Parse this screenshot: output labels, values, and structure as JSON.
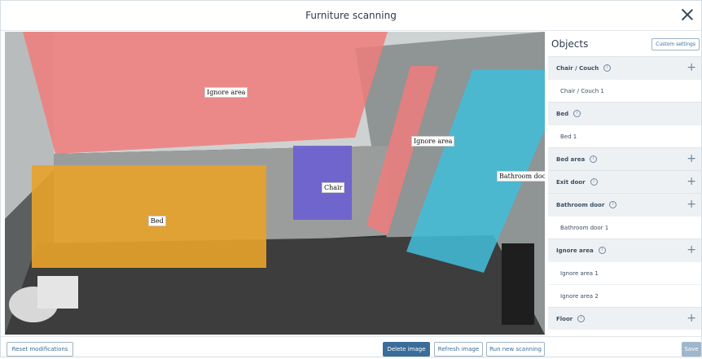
{
  "window": {
    "title": "Furniture scanning"
  },
  "regions": [
    {
      "name": "ignore-area-window",
      "label": "Ignore area",
      "color": "#f07c7c"
    },
    {
      "name": "ignore-area-door",
      "label": "Ignore area",
      "color": "#f07c7c"
    },
    {
      "name": "bed",
      "label": "Bed",
      "color": "#e8a22a"
    },
    {
      "name": "chair",
      "label": "Chair",
      "color": "#6b5fd2"
    },
    {
      "name": "bathroom-door",
      "label": "Bathroom door",
      "color": "#41bedb"
    }
  ],
  "panel": {
    "title": "Objects",
    "custom_settings": "Custom settings",
    "categories": [
      {
        "label": "Chair / Couch",
        "items": [
          "Chair / Couch 1"
        ],
        "addable": true
      },
      {
        "label": "Bed",
        "items": [
          "Bed 1"
        ],
        "addable": false
      },
      {
        "label": "Bed area",
        "items": [],
        "addable": true
      },
      {
        "label": "Exit door",
        "items": [],
        "addable": true
      },
      {
        "label": "Bathroom door",
        "items": [
          "Bathroom door 1"
        ],
        "addable": true
      },
      {
        "label": "Ignore area",
        "items": [
          "Ignore area 1",
          "Ignore area 2"
        ],
        "addable": true
      },
      {
        "label": "Floor",
        "items": [],
        "addable": true
      }
    ]
  },
  "footer": {
    "reset": "Reset modifications",
    "delete": "Delete image",
    "refresh": "Refresh image",
    "run": "Run new scanning",
    "save": "Save"
  }
}
